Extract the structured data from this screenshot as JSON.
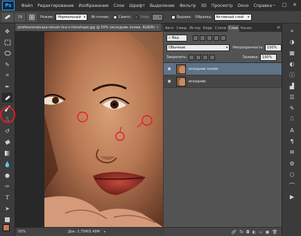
{
  "app": {
    "logo": "Ps"
  },
  "menu": [
    "Файл",
    "Редактирование",
    "Изображение",
    "Слои",
    "Шрифт",
    "Выделение",
    "Фильтр",
    "3D",
    "Просмотр",
    "Окно",
    "Справка"
  ],
  "window_controls": [
    "‒",
    "□",
    "✕"
  ],
  "options_bar": {
    "brush_size": "19",
    "mode_label": "Режим:",
    "mode_value": "Нормальный",
    "source_label": "Источник:",
    "sampled_label": "Семпл.",
    "pattern_label": "Узор:",
    "aligned_label": "Выравн.",
    "sample_label": "Образец:",
    "sample_value": "Активный слой"
  },
  "document": {
    "tab_title": "professionalnaya-retush-lica-v-fotoshope.jpg @ 50% (исходник копия, RGB/8)",
    "zoom": "50%",
    "doc_info": "Док: 2,75M/5,49M"
  },
  "panel_tabs": [
    "Авто",
    "Смеш",
    "Истор",
    "Корр",
    "Стили",
    "Слои",
    "Канал"
  ],
  "panel_active_tab": "Слои",
  "layers_panel": {
    "kind_label": "Вид",
    "blend_mode": "Обычные",
    "opacity_label": "Непрозрачность:",
    "opacity_value": "100%",
    "lock_label": "Закрепить:",
    "fill_label": "Заливка:",
    "fill_value": "100%",
    "layers": [
      {
        "name": "исходник копия",
        "visible": true,
        "selected": true
      },
      {
        "name": "исходник",
        "visible": true,
        "selected": false
      }
    ],
    "bottom_icons": [
      "🔗",
      "fx",
      "◘",
      "◐",
      "▭",
      "▣",
      "🗑"
    ]
  },
  "colors": {
    "foreground": "#c87a56",
    "background": "#ffffff",
    "highlight_red": "#e21b2c",
    "selected_layer": "#5e7288"
  }
}
